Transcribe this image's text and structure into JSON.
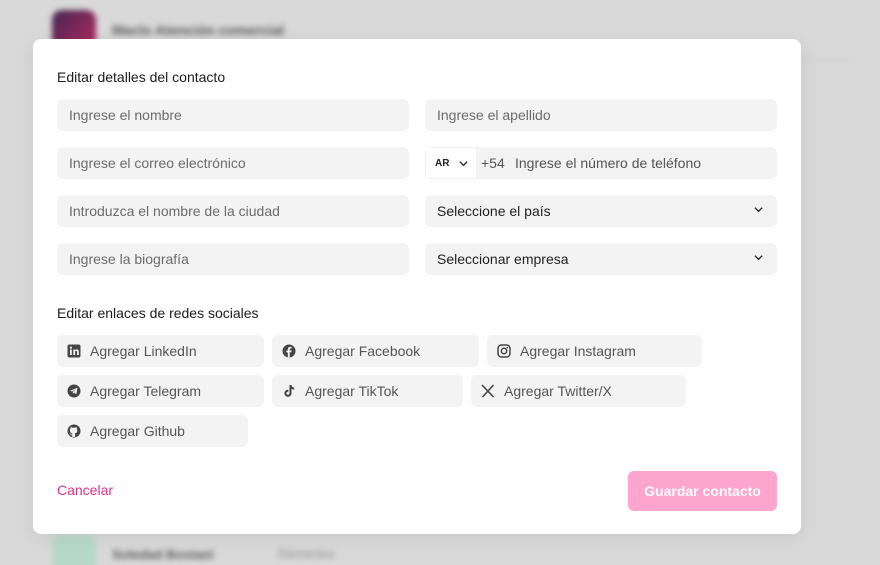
{
  "background": {
    "rows": [
      {
        "name": "Maclo Atención comercial",
        "sub": ""
      },
      {
        "name": "Soledad Bostani",
        "sub": "Elementos"
      }
    ]
  },
  "modal": {
    "details_title": "Editar detalles del contacto",
    "first_name_placeholder": "Ingrese el nombre",
    "last_name_placeholder": "Ingrese el apellido",
    "email_placeholder": "Ingrese el correo electrónico",
    "country_code": "AR",
    "dial_code": "+54",
    "phone_placeholder": "Ingrese el número de teléfono",
    "city_placeholder": "Introduzca el nombre de la ciudad",
    "country_select": "Seleccione el país",
    "bio_placeholder": "Ingrese la biografía",
    "company_select": "Seleccionar empresa",
    "social_title": "Editar enlaces de redes sociales",
    "social": {
      "linkedin": "Agregar LinkedIn",
      "facebook": "Agregar Facebook",
      "instagram": "Agregar Instagram",
      "telegram": "Agregar Telegram",
      "tiktok": "Agregar TikTok",
      "twitter": "Agregar Twitter/X",
      "github": "Agregar Github"
    },
    "cancel_label": "Cancelar",
    "save_label": "Guardar contacto"
  },
  "colors": {
    "accent": "#e0318b",
    "save_disabled": "#fda4cf",
    "field_bg": "#f3f3f3"
  }
}
